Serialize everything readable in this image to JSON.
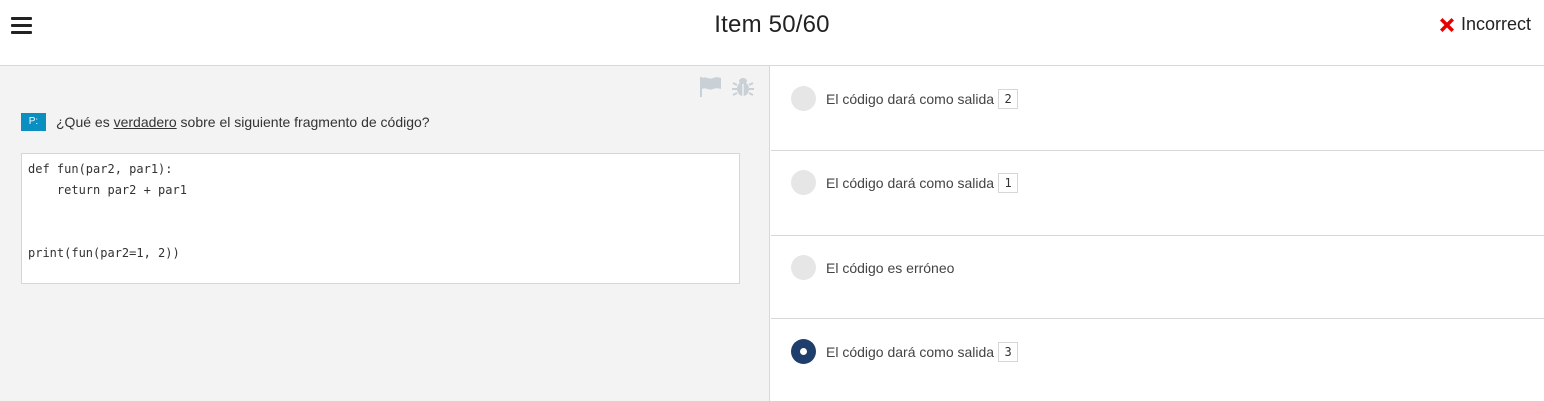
{
  "header": {
    "menu_icon": "hamburger-menu-icon",
    "title": "Item 50/60",
    "result_icon": "red-x-icon",
    "result_label": "Incorrect",
    "result_color": "#e60000"
  },
  "question": {
    "badge": "P:",
    "text_before": "¿Qué es ",
    "text_underlined": "verdadero",
    "text_after": " sobre el siguiente fragmento de código?",
    "code": "def fun(par2, par1):\n    return par2 + par1\n\n\nprint(fun(par2=1, 2))",
    "tools": [
      "flag-icon",
      "bug-icon"
    ]
  },
  "options": [
    {
      "text": "El código dará como salida",
      "code": "2",
      "selected": false
    },
    {
      "text": "El código dará como salida",
      "code": "1",
      "selected": false
    },
    {
      "text": "El código es erróneo",
      "code": "",
      "selected": false
    },
    {
      "text": "El código dará como salida",
      "code": "3",
      "selected": true
    }
  ],
  "colors": {
    "selected_radio": "#1f3e6c",
    "badge": "#0b8fc1"
  }
}
